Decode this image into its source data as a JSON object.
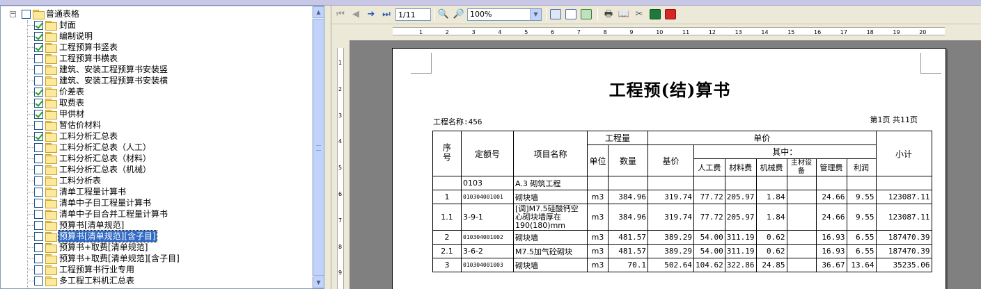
{
  "tree": {
    "root_label": "普通表格",
    "items": [
      {
        "label": "封面",
        "checked": true
      },
      {
        "label": "编制说明",
        "checked": true
      },
      {
        "label": "工程预算书竖表",
        "checked": true
      },
      {
        "label": "工程预算书横表",
        "checked": false
      },
      {
        "label": "建筑、安装工程预算书安装竖",
        "checked": false
      },
      {
        "label": "建筑、安装工程预算书安装横",
        "checked": false
      },
      {
        "label": "价差表",
        "checked": true
      },
      {
        "label": "取费表",
        "checked": true
      },
      {
        "label": "甲供材",
        "checked": true
      },
      {
        "label": "暂估价材料",
        "checked": false
      },
      {
        "label": "工料分析汇总表",
        "checked": true
      },
      {
        "label": "工料分析汇总表（人工）",
        "checked": false
      },
      {
        "label": "工料分析汇总表（材料）",
        "checked": false
      },
      {
        "label": "工料分析汇总表（机械）",
        "checked": false
      },
      {
        "label": "工料分析表",
        "checked": false
      },
      {
        "label": "清单工程量计算书",
        "checked": false
      },
      {
        "label": "清单中子目工程量计算书",
        "checked": false
      },
      {
        "label": "清单中子目合并工程量计算书",
        "checked": false
      },
      {
        "label": "预算书[清单规范]",
        "checked": false
      },
      {
        "label": "预算书[清单规范][含子目]",
        "checked": false,
        "selected": true
      },
      {
        "label": "预算书+取费[清单规范]",
        "checked": false
      },
      {
        "label": "预算书+取费[清单规范][含子目]",
        "checked": false
      },
      {
        "label": "工程预算书行业专用",
        "checked": false
      },
      {
        "label": "多工程工料机汇总表",
        "checked": false
      }
    ]
  },
  "toolbar": {
    "page_value": "1/11",
    "zoom_value": "100%"
  },
  "ruler": {
    "h_ticks": [
      "1",
      "2",
      "3",
      "4",
      "5",
      "6",
      "7",
      "8",
      "9",
      "10",
      "11",
      "12",
      "13",
      "14",
      "15",
      "16",
      "17",
      "18",
      "19",
      "20"
    ],
    "v_ticks": [
      "1",
      "2",
      "3",
      "4",
      "5",
      "6",
      "7",
      "8",
      "9"
    ]
  },
  "document": {
    "title": "工程预(结)算书",
    "project_name": "工程名称:456",
    "page_info": "第1页 共11页",
    "headers": {
      "seq": "序号",
      "code": "定额号",
      "name": "项目名称",
      "quantity_group": "工程量",
      "unit": "单位",
      "qty": "数量",
      "price_group": "单价",
      "base_price": "基价",
      "of_which": "其中：",
      "labor": "人工费",
      "material": "材料费",
      "machine": "机械费",
      "main_material": "主材设备",
      "management": "管理费",
      "profit": "利润",
      "subtotal": "小计"
    },
    "rows": [
      {
        "seq": "",
        "code": "0103",
        "name": "A.3 砌筑工程",
        "unit": "",
        "qty": "",
        "base": "",
        "labor": "",
        "material": "",
        "machine": "",
        "main": "",
        "mgmt": "",
        "profit": "",
        "subtotal": "",
        "code_small": false
      },
      {
        "seq": "1",
        "code": "010304001001",
        "name": "砌块墙",
        "unit": "m3",
        "qty": "384.96",
        "base": "319.74",
        "labor": "77.72",
        "material": "205.97",
        "machine": "1.84",
        "main": "",
        "mgmt": "24.66",
        "profit": "9.55",
        "subtotal": "123087.11",
        "code_small": true
      },
      {
        "seq": "1.1",
        "code": "3-9-1",
        "name": "[调]M7.5硅酸钙空心砌块墙厚在190(180)mm",
        "unit": "m3",
        "qty": "384.96",
        "base": "319.74",
        "labor": "77.72",
        "material": "205.97",
        "machine": "1.84",
        "main": "",
        "mgmt": "24.66",
        "profit": "9.55",
        "subtotal": "123087.11",
        "code_small": false,
        "tall": true
      },
      {
        "seq": "2",
        "code": "010304001002",
        "name": "砌块墙",
        "unit": "m3",
        "qty": "481.57",
        "base": "389.29",
        "labor": "54.00",
        "material": "311.19",
        "machine": "0.62",
        "main": "",
        "mgmt": "16.93",
        "profit": "6.55",
        "subtotal": "187470.39",
        "code_small": true
      },
      {
        "seq": "2.1",
        "code": "3-6-2",
        "name": "M7.5加气砼砌块",
        "unit": "m3",
        "qty": "481.57",
        "base": "389.29",
        "labor": "54.00",
        "material": "311.19",
        "machine": "0.62",
        "main": "",
        "mgmt": "16.93",
        "profit": "6.55",
        "subtotal": "187470.39",
        "code_small": false
      },
      {
        "seq": "3",
        "code": "010304001003",
        "name": "砌块墙",
        "unit": "m3",
        "qty": "70.1",
        "base": "502.64",
        "labor": "104.62",
        "material": "322.86",
        "machine": "24.85",
        "main": "",
        "mgmt": "36.67",
        "profit": "13.64",
        "subtotal": "35235.06",
        "code_small": true
      }
    ]
  }
}
